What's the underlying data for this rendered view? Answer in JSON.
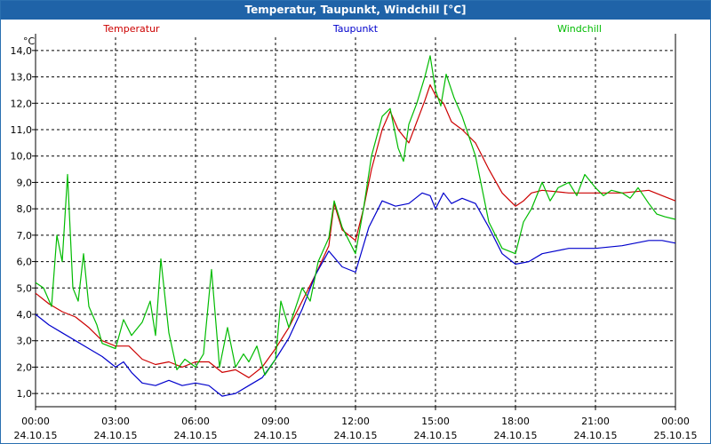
{
  "chart_data": {
    "type": "line",
    "title": "Temperatur, Taupunkt, Windchill [°C]",
    "ylabel": "°C",
    "ylim": [
      0.5,
      14.5
    ],
    "yticks": [
      1.0,
      2.0,
      3.0,
      4.0,
      5.0,
      6.0,
      7.0,
      8.0,
      9.0,
      10.0,
      11.0,
      12.0,
      13.0,
      14.0
    ],
    "ytick_labels": [
      "1,0",
      "2,0",
      "3,0",
      "4,0",
      "5,0",
      "6,0",
      "7,0",
      "8,0",
      "9,0",
      "10,0",
      "11,0",
      "12,0",
      "13,0",
      "14,0"
    ],
    "xlim": [
      0,
      24
    ],
    "xticks": [
      0,
      3,
      6,
      9,
      12,
      15,
      18,
      21,
      24
    ],
    "xtick_labels": [
      {
        "time": "00:00",
        "date": "24.10.15"
      },
      {
        "time": "03:00",
        "date": "24.10.15"
      },
      {
        "time": "06:00",
        "date": "24.10.15"
      },
      {
        "time": "09:00",
        "date": "24.10.15"
      },
      {
        "time": "12:00",
        "date": "24.10.15"
      },
      {
        "time": "15:00",
        "date": "24.10.15"
      },
      {
        "time": "18:00",
        "date": "24.10.15"
      },
      {
        "time": "21:00",
        "date": "24.10.15"
      },
      {
        "time": "00:00",
        "date": "25.10.15"
      }
    ],
    "grid": true,
    "legend_position": "top",
    "series": [
      {
        "name": "Temperatur",
        "color": "#cc0000",
        "points": [
          [
            0,
            4.8
          ],
          [
            0.5,
            4.4
          ],
          [
            1,
            4.1
          ],
          [
            1.5,
            3.9
          ],
          [
            2,
            3.5
          ],
          [
            2.5,
            3.0
          ],
          [
            3,
            2.8
          ],
          [
            3.5,
            2.8
          ],
          [
            4,
            2.3
          ],
          [
            4.5,
            2.1
          ],
          [
            5,
            2.2
          ],
          [
            5.5,
            2.0
          ],
          [
            6,
            2.2
          ],
          [
            6.5,
            2.2
          ],
          [
            7,
            1.8
          ],
          [
            7.5,
            1.9
          ],
          [
            8,
            1.6
          ],
          [
            8.5,
            2.0
          ],
          [
            9,
            2.7
          ],
          [
            9.5,
            3.5
          ],
          [
            10,
            4.5
          ],
          [
            10.5,
            5.5
          ],
          [
            11,
            6.6
          ],
          [
            11.2,
            8.2
          ],
          [
            11.5,
            7.2
          ],
          [
            12,
            6.8
          ],
          [
            12.3,
            8.0
          ],
          [
            12.6,
            9.5
          ],
          [
            13,
            11.0
          ],
          [
            13.3,
            11.7
          ],
          [
            13.6,
            11.0
          ],
          [
            14,
            10.5
          ],
          [
            14.3,
            11.3
          ],
          [
            14.6,
            12.1
          ],
          [
            14.8,
            12.7
          ],
          [
            15,
            12.3
          ],
          [
            15.3,
            12.0
          ],
          [
            15.6,
            11.3
          ],
          [
            16,
            11.0
          ],
          [
            16.5,
            10.5
          ],
          [
            17,
            9.5
          ],
          [
            17.5,
            8.6
          ],
          [
            18,
            8.1
          ],
          [
            18.3,
            8.3
          ],
          [
            18.6,
            8.6
          ],
          [
            19,
            8.7
          ],
          [
            20,
            8.6
          ],
          [
            21,
            8.6
          ],
          [
            22,
            8.6
          ],
          [
            23,
            8.7
          ],
          [
            23.5,
            8.5
          ],
          [
            24,
            8.3
          ]
        ]
      },
      {
        "name": "Taupunkt",
        "color": "#0000cc",
        "points": [
          [
            0,
            4.0
          ],
          [
            0.5,
            3.6
          ],
          [
            1,
            3.3
          ],
          [
            1.5,
            3.0
          ],
          [
            2,
            2.7
          ],
          [
            2.5,
            2.4
          ],
          [
            3,
            2.0
          ],
          [
            3.3,
            2.2
          ],
          [
            3.6,
            1.8
          ],
          [
            4,
            1.4
          ],
          [
            4.5,
            1.3
          ],
          [
            5,
            1.5
          ],
          [
            5.5,
            1.3
          ],
          [
            6,
            1.4
          ],
          [
            6.5,
            1.3
          ],
          [
            7,
            0.9
          ],
          [
            7.5,
            1.0
          ],
          [
            8,
            1.3
          ],
          [
            8.5,
            1.6
          ],
          [
            9,
            2.3
          ],
          [
            9.5,
            3.1
          ],
          [
            10,
            4.2
          ],
          [
            10.5,
            5.5
          ],
          [
            11,
            6.4
          ],
          [
            11.5,
            5.8
          ],
          [
            12,
            5.6
          ],
          [
            12.5,
            7.3
          ],
          [
            13,
            8.3
          ],
          [
            13.5,
            8.1
          ],
          [
            14,
            8.2
          ],
          [
            14.5,
            8.6
          ],
          [
            14.8,
            8.5
          ],
          [
            15,
            8.0
          ],
          [
            15.3,
            8.6
          ],
          [
            15.6,
            8.2
          ],
          [
            16,
            8.4
          ],
          [
            16.5,
            8.2
          ],
          [
            17,
            7.3
          ],
          [
            17.5,
            6.3
          ],
          [
            18,
            5.9
          ],
          [
            18.5,
            6.0
          ],
          [
            19,
            6.3
          ],
          [
            20,
            6.5
          ],
          [
            21,
            6.5
          ],
          [
            22,
            6.6
          ],
          [
            23,
            6.8
          ],
          [
            23.5,
            6.8
          ],
          [
            24,
            6.7
          ]
        ]
      },
      {
        "name": "Windchill",
        "color": "#00bb00",
        "points": [
          [
            0,
            5.2
          ],
          [
            0.3,
            5.0
          ],
          [
            0.6,
            4.3
          ],
          [
            0.8,
            7.0
          ],
          [
            1,
            6.0
          ],
          [
            1.2,
            9.3
          ],
          [
            1.4,
            5.0
          ],
          [
            1.6,
            4.5
          ],
          [
            1.8,
            6.3
          ],
          [
            2,
            4.3
          ],
          [
            2.3,
            3.6
          ],
          [
            2.5,
            2.9
          ],
          [
            3,
            2.7
          ],
          [
            3.3,
            3.8
          ],
          [
            3.6,
            3.2
          ],
          [
            4,
            3.7
          ],
          [
            4.3,
            4.5
          ],
          [
            4.5,
            3.2
          ],
          [
            4.7,
            6.1
          ],
          [
            5,
            3.3
          ],
          [
            5.3,
            1.9
          ],
          [
            5.6,
            2.3
          ],
          [
            6,
            2.0
          ],
          [
            6.3,
            2.5
          ],
          [
            6.6,
            5.7
          ],
          [
            6.9,
            2.0
          ],
          [
            7.2,
            3.5
          ],
          [
            7.5,
            2.0
          ],
          [
            7.8,
            2.5
          ],
          [
            8,
            2.2
          ],
          [
            8.3,
            2.8
          ],
          [
            8.6,
            1.7
          ],
          [
            9,
            2.3
          ],
          [
            9.2,
            4.5
          ],
          [
            9.5,
            3.5
          ],
          [
            10,
            5.0
          ],
          [
            10.3,
            4.5
          ],
          [
            10.6,
            6.0
          ],
          [
            11,
            6.9
          ],
          [
            11.2,
            8.3
          ],
          [
            11.5,
            7.3
          ],
          [
            12,
            6.3
          ],
          [
            12.3,
            8.0
          ],
          [
            12.6,
            10.0
          ],
          [
            13,
            11.5
          ],
          [
            13.3,
            11.8
          ],
          [
            13.6,
            10.3
          ],
          [
            13.8,
            9.8
          ],
          [
            14,
            11.2
          ],
          [
            14.3,
            12.0
          ],
          [
            14.6,
            13.0
          ],
          [
            14.8,
            13.8
          ],
          [
            15,
            12.5
          ],
          [
            15.2,
            11.9
          ],
          [
            15.4,
            13.1
          ],
          [
            15.7,
            12.2
          ],
          [
            16,
            11.5
          ],
          [
            16.5,
            10.0
          ],
          [
            17,
            7.5
          ],
          [
            17.5,
            6.5
          ],
          [
            18,
            6.3
          ],
          [
            18.3,
            7.5
          ],
          [
            18.6,
            8.0
          ],
          [
            19,
            9.0
          ],
          [
            19.3,
            8.3
          ],
          [
            19.6,
            8.8
          ],
          [
            20,
            9.0
          ],
          [
            20.3,
            8.5
          ],
          [
            20.6,
            9.3
          ],
          [
            21,
            8.8
          ],
          [
            21.3,
            8.5
          ],
          [
            21.6,
            8.7
          ],
          [
            22,
            8.6
          ],
          [
            22.3,
            8.4
          ],
          [
            22.6,
            8.8
          ],
          [
            23,
            8.2
          ],
          [
            23.3,
            7.8
          ],
          [
            23.6,
            7.7
          ],
          [
            24,
            7.6
          ]
        ]
      }
    ]
  }
}
